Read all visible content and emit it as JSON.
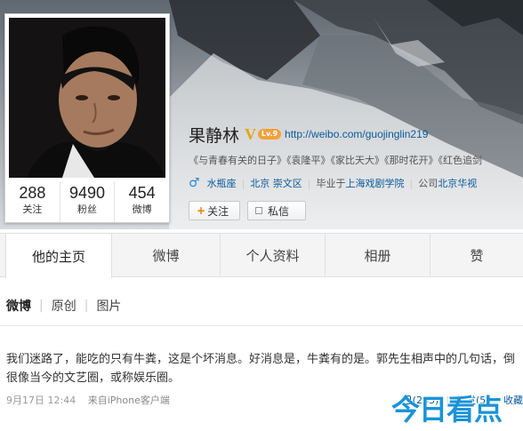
{
  "profile": {
    "name": "果静林",
    "verified_badge": "V",
    "level_badge": "Lv.9",
    "url": "http://weibo.com/guojinglin219",
    "works": "《与青春有关的日子》《袁隆平》《家比天大》《那时花开》《红色追剑",
    "gender_icon": "♂",
    "zodiac": "水瓶座",
    "location": "北京 崇文区",
    "school_prefix": "毕业于",
    "school": "上海戏剧学院",
    "company_prefix": "公司",
    "company": "北京华视",
    "stats": [
      {
        "value": "288",
        "label": "关注"
      },
      {
        "value": "9490",
        "label": "粉丝"
      },
      {
        "value": "454",
        "label": "微博"
      }
    ],
    "follow_label": "关注",
    "message_label": "私信"
  },
  "tabs": [
    "他的主页",
    "微博",
    "个人资料",
    "相册",
    "赞"
  ],
  "filters": [
    "微博",
    "原创",
    "图片"
  ],
  "post": {
    "text": "我们迷路了，能吃的只有牛粪，这是个坏消息。好消息是，牛粪有的是。郭先生相声中的几句话，倒很像当今的文艺圈，或称娱乐圈。",
    "time": "9月17日 12:44",
    "source": "来自iPhone客户端",
    "likes": "(263)",
    "forward": "转发(5",
    "collect": "收藏"
  },
  "watermark": "今日看点",
  "colors": {
    "link": "#0a5a9c",
    "verified": "#e8a400",
    "watermark": "#1a93d8"
  }
}
